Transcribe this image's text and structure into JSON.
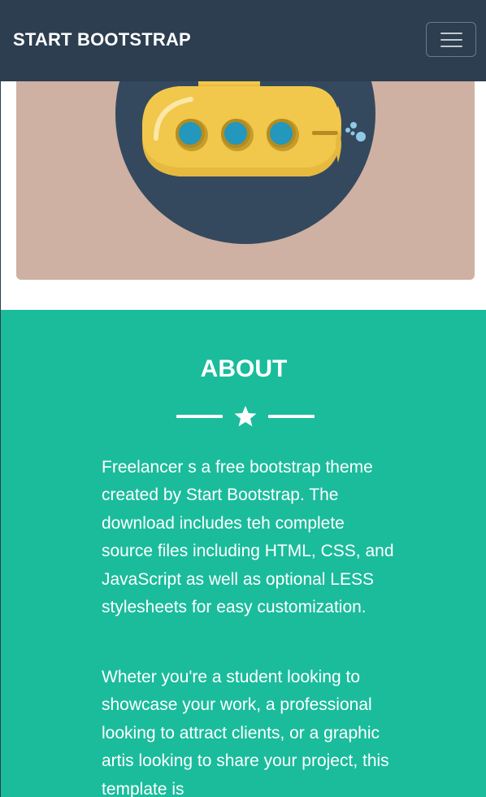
{
  "navbar": {
    "brand": "START BOOTSTRAP",
    "menu_icon": "hamburger-menu-icon"
  },
  "portfolio": {
    "image_icon": "submarine-illustration",
    "colors": {
      "card_background": "#ceb1a2",
      "circle": "#34495e",
      "hull": "#f1c84c",
      "porthole": "#2397bc"
    }
  },
  "about": {
    "title": "ABOUT",
    "divider_icon": "star-icon",
    "paragraphs": [
      "Freelancer s a free bootstrap theme created by Start Bootstrap. The download includes teh complete source files including HTML, CSS, and JavaScript as well as optional LESS stylesheets for easy customization.",
      "Wheter you're a student looking to showcase your work, a professional looking to attract clients, or a graphic artis looking to share your project, this template is"
    ]
  },
  "colors": {
    "navbar": "#2c3e50",
    "accent": "#1abc9c",
    "text_on_accent": "#ffffff"
  }
}
